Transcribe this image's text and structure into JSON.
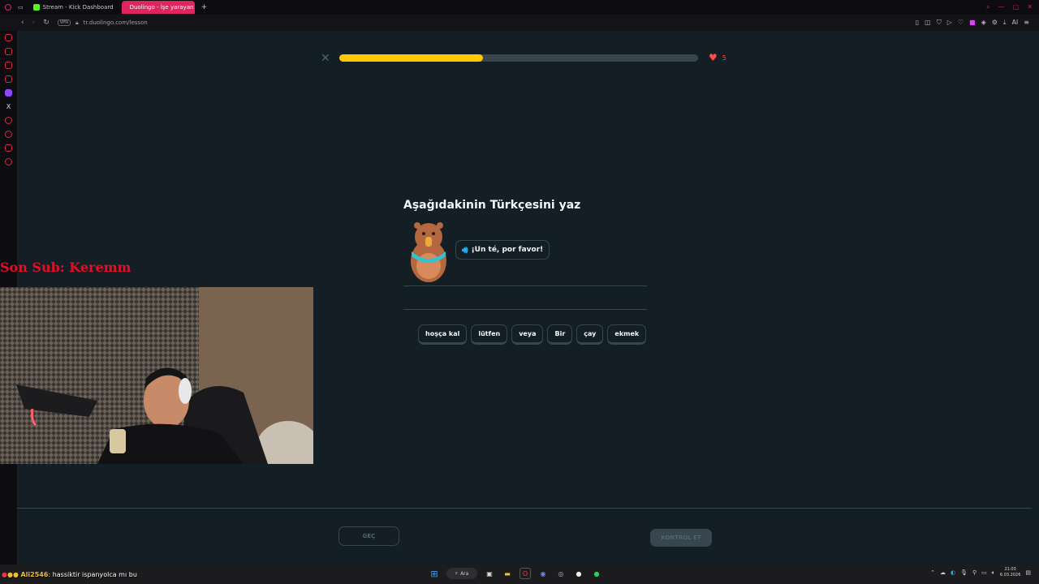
{
  "browser": {
    "tabs": [
      {
        "label": "Stream - Kick Dashboard",
        "active": false
      },
      {
        "label": "Duolingo - İşe yarayan de",
        "active": true
      }
    ],
    "url": "tr.duolingo.com/lesson",
    "vpn_label": "VPN",
    "ai_label": "AI"
  },
  "lesson": {
    "progress": 0.4,
    "hearts": "5",
    "prompt": "Aşağıdakinin Türkçesini yaz",
    "sentence": "¡Un té, por favor!",
    "word_bank": [
      "hoşça kal",
      "lütfen",
      "veya",
      "Bir",
      "çay",
      "ekmek"
    ],
    "skip_label": "GEÇ",
    "check_label": "KONTROL ET"
  },
  "stream_overlay": {
    "last_sub": "Son Sub: Keremm",
    "chat_user": "Ali2546",
    "chat_message": ": hassiktir ispanyolca mı bu"
  },
  "taskbar": {
    "search_label": "Ara",
    "time": "21:03",
    "date": "6.03.2026"
  },
  "colors": {
    "progress_fill": "#ffc800",
    "heart": "#ff4b4b",
    "accent_tab": "#e0245e",
    "overlay_red": "#e0102a"
  }
}
